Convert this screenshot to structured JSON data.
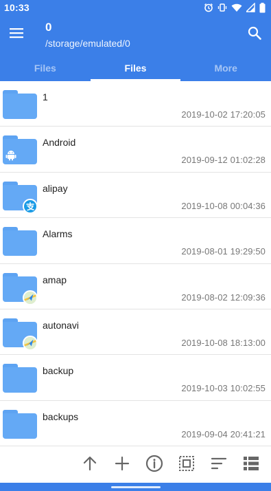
{
  "status_bar": {
    "time": "10:33",
    "icons": [
      "alarm-icon",
      "vibrate-icon",
      "wifi-icon",
      "signal-icon",
      "battery-icon"
    ]
  },
  "app_bar": {
    "title": "0",
    "subtitle": "/storage/emulated/0",
    "menu_icon": "menu-icon",
    "search_icon": "search-icon"
  },
  "tabs": [
    {
      "label": "Files",
      "active": false
    },
    {
      "label": "Files",
      "active": true
    },
    {
      "label": "More",
      "active": false
    }
  ],
  "files": [
    {
      "name": "1",
      "date": "2019-10-02 17:20:05",
      "badge": ""
    },
    {
      "name": "Android",
      "date": "2019-09-12 01:02:28",
      "badge": "android-icon"
    },
    {
      "name": "alipay",
      "date": "2019-10-08 00:04:36",
      "badge": "alipay-icon"
    },
    {
      "name": "Alarms",
      "date": "2019-08-01 19:29:50",
      "badge": ""
    },
    {
      "name": "amap",
      "date": "2019-08-02 12:09:36",
      "badge": "amap-icon"
    },
    {
      "name": "autonavi",
      "date": "2019-10-08 18:13:00",
      "badge": "amap-icon"
    },
    {
      "name": "backup",
      "date": "2019-10-03 10:02:55",
      "badge": ""
    },
    {
      "name": "backups",
      "date": "2019-09-04 20:41:21",
      "badge": ""
    }
  ],
  "toolbar": [
    "arrow-up-icon",
    "plus-icon",
    "info-icon",
    "select-icon",
    "sort-icon",
    "list-view-icon"
  ],
  "colors": {
    "primary": "#3b7fe8",
    "folder": "#64a9f5",
    "alipay": "#1a9be6"
  }
}
